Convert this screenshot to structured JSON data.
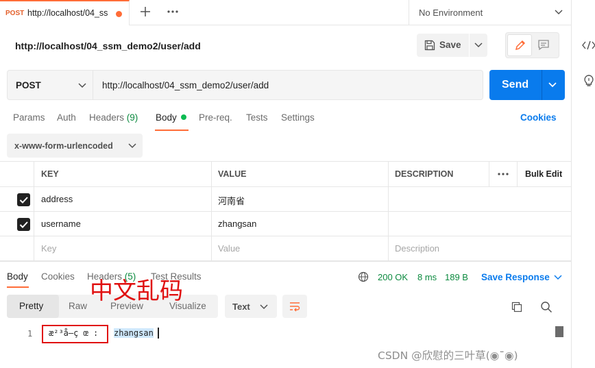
{
  "tab": {
    "method": "POST",
    "title": "http://localhost/04_ss"
  },
  "environment": {
    "label": "No Environment"
  },
  "request": {
    "name": "http://localhost/04_ssm_demo2/user/add",
    "method": "POST",
    "url": "http://localhost/04_ssm_demo2/user/add"
  },
  "toolbar": {
    "save_label": "Save",
    "send_label": "Send"
  },
  "request_tabs": {
    "params": "Params",
    "auth": "Auth",
    "headers": "Headers",
    "headers_count": "(9)",
    "body": "Body",
    "prereq": "Pre-req.",
    "tests": "Tests",
    "settings": "Settings",
    "cookies": "Cookies"
  },
  "body_type": "x-www-form-urlencoded",
  "table": {
    "headers": {
      "key": "KEY",
      "value": "VALUE",
      "description": "DESCRIPTION",
      "bulk_edit": "Bulk Edit"
    },
    "rows": [
      {
        "key": "address",
        "value": "河南省",
        "checked": true
      },
      {
        "key": "username",
        "value": "zhangsan",
        "checked": true
      }
    ],
    "placeholders": {
      "key": "Key",
      "value": "Value",
      "description": "Description"
    }
  },
  "response": {
    "tabs": {
      "body": "Body",
      "cookies": "Cookies",
      "headers": "Headers",
      "headers_count": "(5)",
      "test_results": "Test Results"
    },
    "status": "200 OK",
    "time": "8 ms",
    "size": "189 B",
    "save_label": "Save Response",
    "views": {
      "pretty": "Pretty",
      "raw": "Raw",
      "preview": "Preview",
      "visualize": "Visualize"
    },
    "format": "Text",
    "line_number": "1",
    "garbled": "æ²³å—ç œ :",
    "value": "zhangsan"
  },
  "annotation": {
    "text": "中文乱码",
    "color": "#e01010"
  },
  "watermark": "CSDN @欣慰的三叶草(◉¯̈◉)",
  "colors": {
    "accent": "#ff6c37",
    "primary": "#097bed",
    "success": "#0cbb52"
  }
}
